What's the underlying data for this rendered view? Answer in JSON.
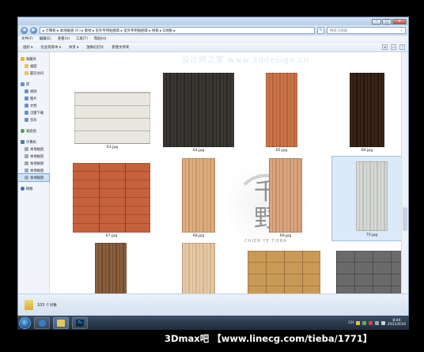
{
  "window": {
    "min_label": "–",
    "max_label": "□",
    "close_label": "✕"
  },
  "address": {
    "back": "◀",
    "forward": "▶",
    "path": "▸ 计算机 ▸ 本地磁盘 (F:) ▸ 素材 ▸ 室外专用贴图库 ▸ 室外专用贴图库 ▸ 材质 ▸ D地板 ▸",
    "refresh": "↻",
    "search_placeholder": "搜索 D地板",
    "search_icon": "search-icon"
  },
  "menu": [
    "文件(F)",
    "编辑(E)",
    "查看(V)",
    "工具(T)",
    "帮助(H)"
  ],
  "toolbar": [
    "组织 ▾",
    "包含到库中 ▾",
    "共享 ▾",
    "放映幻灯片",
    "新建文件夹"
  ],
  "toolbar_right_icons": [
    "≣",
    "▭",
    "?"
  ],
  "sidebar": {
    "groups": [
      {
        "items": [
          {
            "label": "收藏夹",
            "icon": "star",
            "sub": false
          },
          {
            "label": "桌面",
            "icon": "folder",
            "sub": true
          },
          {
            "label": "最近访问",
            "icon": "folder",
            "sub": true
          }
        ]
      },
      {
        "items": [
          {
            "label": "库",
            "icon": "lib",
            "sub": false
          },
          {
            "label": "视频",
            "icon": "lib",
            "sub": true
          },
          {
            "label": "图片",
            "icon": "lib",
            "sub": true
          },
          {
            "label": "文档",
            "icon": "lib",
            "sub": true
          },
          {
            "label": "迅雷下载",
            "icon": "lib",
            "sub": true
          },
          {
            "label": "音乐",
            "icon": "lib",
            "sub": true
          }
        ]
      },
      {
        "items": [
          {
            "label": "家庭组",
            "icon": "home",
            "sub": false
          }
        ]
      },
      {
        "items": [
          {
            "label": "计算机",
            "icon": "pc",
            "sub": false
          },
          {
            "label": "本地磁盘",
            "icon": "drive",
            "sub": true
          },
          {
            "label": "本地磁盘",
            "icon": "drive",
            "sub": true
          },
          {
            "label": "本地磁盘",
            "icon": "drive",
            "sub": true
          },
          {
            "label": "本地磁盘",
            "icon": "drive",
            "sub": true
          },
          {
            "label": "本地磁盘",
            "icon": "drive",
            "sub": true,
            "selected": true
          }
        ]
      },
      {
        "items": [
          {
            "label": "网络",
            "icon": "net",
            "sub": false
          }
        ]
      }
    ]
  },
  "thumbnails": [
    {
      "file": "63.jpg",
      "colors": [
        "#e9e7df",
        "#d4d1c6"
      ],
      "pattern": "hplank"
    },
    {
      "file": "64.jpg",
      "colors": [
        "#3b3733",
        "#2a2724"
      ],
      "pattern": "vgrain"
    },
    {
      "file": "65.jpg",
      "colors": [
        "#c9754a",
        "#b5603a"
      ],
      "pattern": "vgrain"
    },
    {
      "file": "66.jpg",
      "colors": [
        "#3a2418",
        "#25160e"
      ],
      "pattern": "vgrain"
    },
    {
      "file": "67.jpg",
      "colors": [
        "#c4623c",
        "#a94c2c"
      ],
      "pattern": "brick"
    },
    {
      "file": "68.jpg",
      "colors": [
        "#dcae7e",
        "#c9966a"
      ],
      "pattern": "vgrain"
    },
    {
      "file": "69.jpg",
      "colors": [
        "#d9a57e",
        "#c68f68"
      ],
      "pattern": "vgrain"
    },
    {
      "file": "70.jpg",
      "colors": [
        "#d6d8d3",
        "#bfc2bc"
      ],
      "pattern": "vgrain",
      "selected": true
    },
    {
      "file": "",
      "colors": [
        "#8a5f3f",
        "#6d4a30"
      ],
      "pattern": "vgrain"
    },
    {
      "file": "",
      "colors": [
        "#e5c9a6",
        "#d4b38c"
      ],
      "pattern": "vgrain"
    },
    {
      "file": "",
      "colors": [
        "#c99a55",
        "#a97c3e"
      ],
      "pattern": "parquet"
    },
    {
      "file": "",
      "colors": [
        "#6a6a6a",
        "#4e4e4e"
      ],
      "pattern": "parquet"
    }
  ],
  "watermark_text": "设计师之家 www.3ddesign.cn",
  "seal": {
    "char1": "千",
    "char2": "野",
    "stamp": "CHIEN YE TIEBA"
  },
  "status": {
    "count": "103 个对象"
  },
  "taskbar": {
    "apps": [
      "ie",
      "explorer",
      "photoshop"
    ],
    "ps_label": "Ps",
    "time": "8:44",
    "date": "2011/4/16",
    "lang": "CH"
  },
  "caption": "3Dmax吧 【www.linecg.com/tieba/1771】"
}
